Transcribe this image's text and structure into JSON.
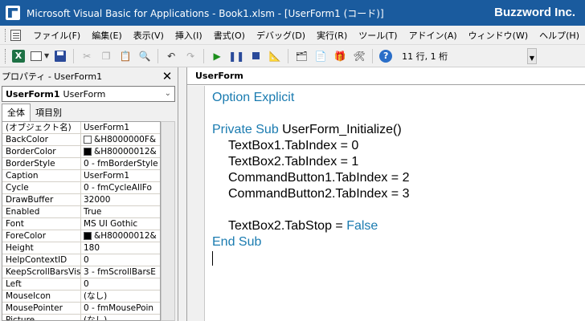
{
  "window": {
    "title": "Microsoft Visual Basic for Applications - Book1.xlsm - [UserForm1 (コード)]",
    "brand": "Buzzword Inc."
  },
  "menu": {
    "items": [
      "ファイル(F)",
      "編集(E)",
      "表示(V)",
      "挿入(I)",
      "書式(O)",
      "デバッグ(D)",
      "実行(R)",
      "ツール(T)",
      "アドイン(A)",
      "ウィンドウ(W)",
      "ヘルプ(H)"
    ]
  },
  "toolbar": {
    "excel_label": "X",
    "cursor_position": "11 行, 1 桁"
  },
  "properties": {
    "header": "プロパティ - UserForm1",
    "selector_name": "UserForm1",
    "selector_type": "UserForm",
    "tabs": [
      "全体",
      "項目別"
    ],
    "rows": [
      {
        "name": "(オブジェクト名)",
        "value": "UserForm1",
        "swatch": ""
      },
      {
        "name": "BackColor",
        "value": "&H8000000F&",
        "swatch": "#ffffff"
      },
      {
        "name": "BorderColor",
        "value": "&H80000012&",
        "swatch": "#000000"
      },
      {
        "name": "BorderStyle",
        "value": "0 - fmBorderStyle",
        "swatch": ""
      },
      {
        "name": "Caption",
        "value": "UserForm1",
        "swatch": ""
      },
      {
        "name": "Cycle",
        "value": "0 - fmCycleAllFo",
        "swatch": ""
      },
      {
        "name": "DrawBuffer",
        "value": "32000",
        "swatch": ""
      },
      {
        "name": "Enabled",
        "value": "True",
        "swatch": ""
      },
      {
        "name": "Font",
        "value": "MS UI Gothic",
        "swatch": ""
      },
      {
        "name": "ForeColor",
        "value": "&H80000012&",
        "swatch": "#000000"
      },
      {
        "name": "Height",
        "value": "180",
        "swatch": ""
      },
      {
        "name": "HelpContextID",
        "value": "0",
        "swatch": ""
      },
      {
        "name": "KeepScrollBarsVis",
        "value": "3 - fmScrollBarsE",
        "swatch": ""
      },
      {
        "name": "Left",
        "value": "0",
        "swatch": ""
      },
      {
        "name": "MouseIcon",
        "value": "(なし)",
        "swatch": ""
      },
      {
        "name": "MousePointer",
        "value": "0 - fmMousePoin",
        "swatch": ""
      },
      {
        "name": "Picture",
        "value": "(なし)",
        "swatch": ""
      }
    ]
  },
  "code": {
    "object_name": "UserForm",
    "option_explicit": "Option Explicit",
    "sub_keyword": "Private Sub",
    "sub_name": "UserForm_Initialize()",
    "line1": "TextBox1.TabIndex = 0",
    "line2": "TextBox2.TabIndex = 1",
    "line3": "CommandButton1.TabIndex = 2",
    "line4": "CommandButton2.TabIndex = 3",
    "tabstop_stmt": "TextBox2.TabStop = ",
    "tabstop_value": "False",
    "end_sub": "End Sub"
  },
  "colors": {
    "title_bar": "#1a5b9e",
    "keyword": "#1a7bb0"
  }
}
